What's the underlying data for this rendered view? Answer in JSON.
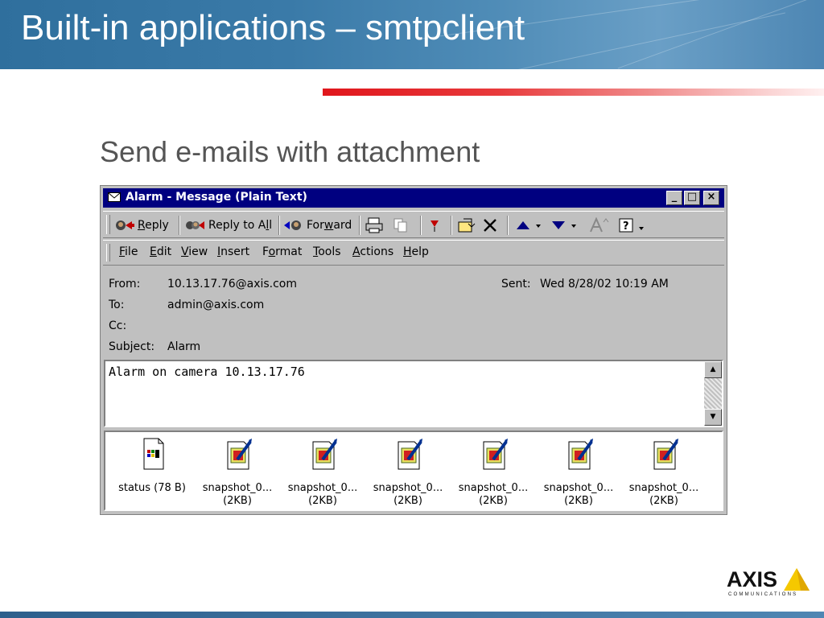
{
  "slide": {
    "title": "Built-in applications – smtpclient",
    "subtitle": "Send e-mails with attachment"
  },
  "logo": {
    "word": "AXIS",
    "tagline": "COMMUNICATIONS"
  },
  "window": {
    "title": "Alarm - Message (Plain Text)",
    "controls": {
      "minimize": "_",
      "maximize": "□",
      "close": "×"
    }
  },
  "toolbar": {
    "reply": {
      "pre": "",
      "key": "R",
      "post": "eply"
    },
    "reply_all": {
      "pre": "Reply to A",
      "key": "l",
      "post": "l"
    },
    "forward": {
      "pre": "For",
      "key": "w",
      "post": "ard"
    },
    "icons": [
      "reply-icon",
      "reply-all-icon",
      "forward-icon",
      "print-icon",
      "copy-icon",
      "flag-icon",
      "move-to-folder-icon",
      "delete-icon",
      "previous-item-icon",
      "next-item-icon",
      "font-size-icon",
      "help-icon"
    ]
  },
  "menu": {
    "file": {
      "key": "F",
      "rest": "ile"
    },
    "edit": {
      "key": "E",
      "rest": "dit"
    },
    "view": {
      "key": "V",
      "rest": "iew"
    },
    "insert": {
      "key": "I",
      "rest": "nsert"
    },
    "format": {
      "pre": "F",
      "key": "o",
      "rest": "rmat"
    },
    "tools": {
      "key": "T",
      "rest": "ools"
    },
    "actions": {
      "key": "A",
      "rest": "ctions"
    },
    "help": {
      "key": "H",
      "rest": "elp"
    }
  },
  "message": {
    "from_label": "From:",
    "from_value": "10.13.17.76@axis.com",
    "to_label": "To:",
    "to_value": "admin@axis.com",
    "cc_label": "Cc:",
    "cc_value": "",
    "subject_label": "Subject:",
    "subject_value": "Alarm",
    "sent_label": "Sent:",
    "sent_value": "Wed 8/28/02 10:19 AM",
    "body": "Alarm on camera 10.13.17.76"
  },
  "attachments": [
    {
      "name": "status (78 B)",
      "size": "",
      "icon": "text-file-icon"
    },
    {
      "name": "snapshot_0...",
      "size": "(2KB)",
      "icon": "image-file-icon"
    },
    {
      "name": "snapshot_0...",
      "size": "(2KB)",
      "icon": "image-file-icon"
    },
    {
      "name": "snapshot_0...",
      "size": "(2KB)",
      "icon": "image-file-icon"
    },
    {
      "name": "snapshot_0...",
      "size": "(2KB)",
      "icon": "image-file-icon"
    },
    {
      "name": "snapshot_0...",
      "size": "(2KB)",
      "icon": "image-file-icon"
    },
    {
      "name": "snapshot_0...",
      "size": "(2KB)",
      "icon": "image-file-icon"
    }
  ],
  "colors": {
    "titlebar": "#000080",
    "window_face": "#c0c0c0",
    "header_band": "#3a7aa8",
    "accent_red": "#e0161c",
    "logo_yellow": "#f5c800"
  }
}
